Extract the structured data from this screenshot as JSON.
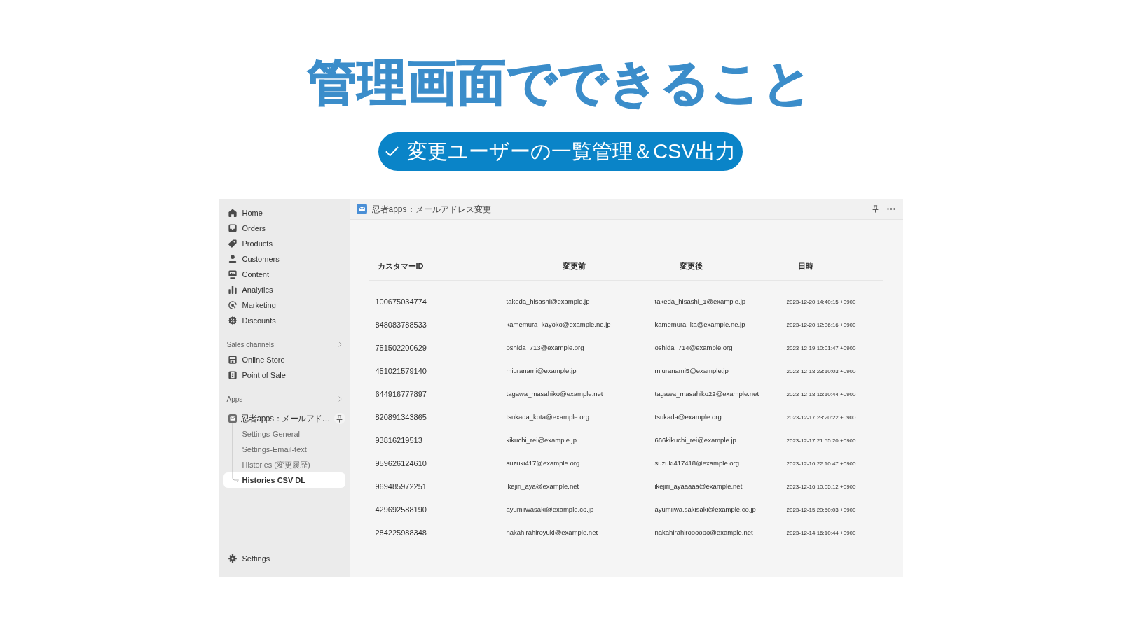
{
  "headline": "管理画面でできること",
  "feature_badge": {
    "label": "変更ユーザーの一覧管理＆CSV出力"
  },
  "sidebar": {
    "nav_items": [
      {
        "label": "Home",
        "kind": "home",
        "selected": false
      },
      {
        "label": "Orders",
        "kind": "orders",
        "selected": false
      },
      {
        "label": "Products",
        "kind": "products",
        "selected": false
      },
      {
        "label": "Customers",
        "kind": "customers",
        "selected": false
      },
      {
        "label": "Content",
        "kind": "content",
        "selected": false
      },
      {
        "label": "Analytics",
        "kind": "analytics",
        "selected": false
      },
      {
        "label": "Marketing",
        "kind": "marketing",
        "selected": false
      },
      {
        "label": "Discounts",
        "kind": "discounts",
        "selected": false
      }
    ],
    "sections": [
      {
        "heading": "Sales channels",
        "items": [
          {
            "label": "Online Store",
            "kind": "store",
            "selected": false
          },
          {
            "label": "Point of Sale",
            "kind": "pos",
            "selected": false
          }
        ]
      },
      {
        "heading": "Apps",
        "items": [
          {
            "label": "忍者apps：メールアド…",
            "kind": "app",
            "selected": false,
            "children": [
              {
                "label": "Settings-General",
                "selected": false
              },
              {
                "label": "Settings-Email-text",
                "selected": false
              },
              {
                "label": "Histories (変更履歴)",
                "selected": false
              },
              {
                "label": "Histories CSV DL",
                "selected": true
              }
            ]
          }
        ]
      }
    ],
    "footer_item": {
      "label": "Settings",
      "kind": "settings",
      "selected": false
    }
  },
  "app_header": {
    "title": "忍者apps：メールアドレス変更"
  },
  "table": {
    "columns": [
      "カスタマーID",
      "変更前",
      "変更後",
      "日時"
    ],
    "rows": [
      [
        "100675034774",
        "takeda_hisashi@example.jp",
        "takeda_hisashi_1@example.jp",
        "2023-12-20 14:40:15 +0900"
      ],
      [
        "848083788533",
        "kamemura_kayoko@example.ne.jp",
        "kamemura_ka@example.ne.jp",
        "2023-12-20 12:36:16 +0900"
      ],
      [
        "751502200629",
        "oshida_713@example.org",
        "oshida_714@example.org",
        "2023-12-19 10:01:47 +0900"
      ],
      [
        "451021579140",
        "miuranami@example.jp",
        "miuranami5@example.jp",
        "2023-12-18 23:10:03 +0900"
      ],
      [
        "644916777897",
        "tagawa_masahiko@example.net",
        "tagawa_masahiko22@example.net",
        "2023-12-18 16:10:44 +0900"
      ],
      [
        "820891343865",
        "tsukada_kota@example.org",
        "tsukada@example.org",
        "2023-12-17 23:20:22 +0900"
      ],
      [
        "93816219513",
        "kikuchi_rei@example.jp",
        "666kikuchi_rei@example.jp",
        "2023-12-17 21:55:20 +0900"
      ],
      [
        "959626124610",
        "suzuki417@example.org",
        "suzuki417418@example.org",
        "2023-12-16 22:10:47 +0900"
      ],
      [
        "969485972251",
        "ikejiri_aya@example.net",
        "ikejiri_ayaaaaa@example.net",
        "2023-12-16 10:05:12 +0900"
      ],
      [
        "429692588190",
        "ayumiiwasaki@example.co.jp",
        "ayumiiwa.sakisaki@example.co.jp",
        "2023-12-15 20:50:03 +0900"
      ],
      [
        "284225988348",
        "nakahirahiroyuki@example.net",
        "nakahirahiroooooo@example.net",
        "2023-12-14 16:10:44 +0900"
      ]
    ]
  }
}
